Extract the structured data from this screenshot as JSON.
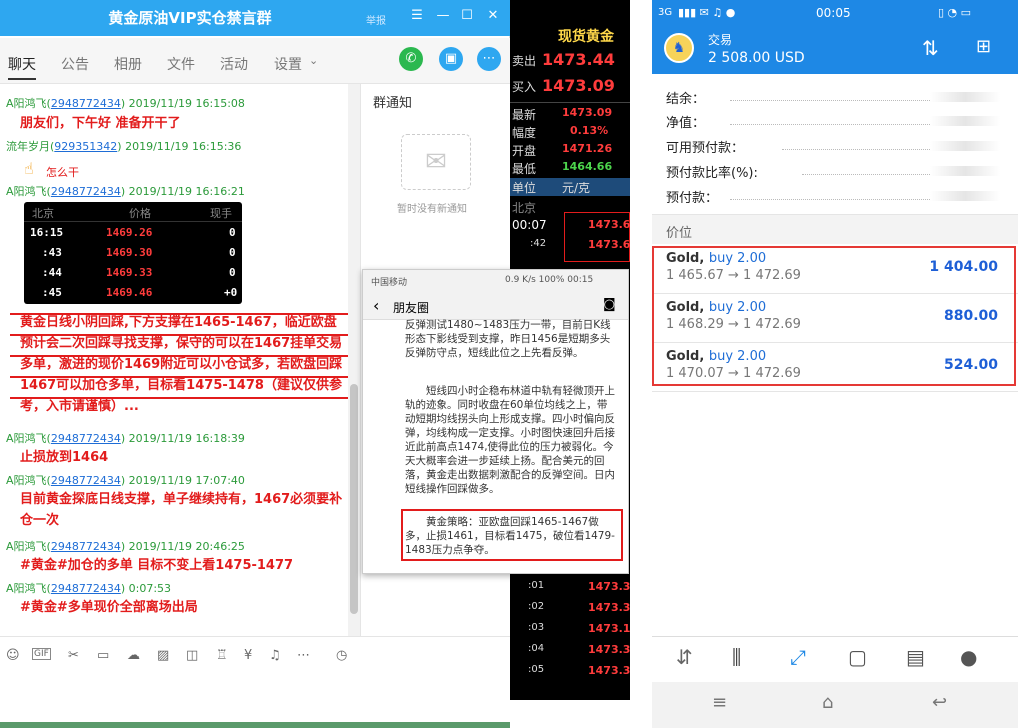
{
  "qq": {
    "title": "黄金原油VIP实仓禁言群",
    "report": "举报",
    "tabs": [
      "聊天",
      "公告",
      "相册",
      "文件",
      "活动",
      "设置"
    ],
    "messages": [
      {
        "name": "A阳鸿飞",
        "qq": "2948772434",
        "time": "2019/11/19 16:15:08",
        "text": "朋友们，下午好 准备开干了"
      },
      {
        "name": "流年岁月",
        "qq": "929351342",
        "time": "2019/11/19 16:15:36",
        "text": "怎么干"
      },
      {
        "name": "A阳鸿飞",
        "qq": "2948772434",
        "time": "2019/11/19 16:16:21"
      },
      {
        "text": "黄金日线小阴回踩,下方支撑在1465-1467，临近欧盘预计会二次回踩寻找支撑，保守的可以在1467挂单交易多单，激进的现价1469附近可以小仓试多，若欧盘回踩1467可以加仓多单，目标看1475-1478（建议仅供参考，入市请谨慎）..."
      },
      {
        "name": "A阳鸿飞",
        "qq": "2948772434",
        "time": "2019/11/19 16:18:39",
        "text": "止损放到1464"
      },
      {
        "name": "A阳鸿飞",
        "qq": "2948772434",
        "time": "2019/11/19 17:07:40",
        "text": "目前黄金探底日线支撑，单子继续持有，1467必须要补仓一次"
      },
      {
        "name": "A阳鸿飞",
        "qq": "2948772434",
        "time": "2019/11/19 20:46:25",
        "text": "#黄金#加仓的多单 目标不变上看1475-1477"
      },
      {
        "name": "A阳鸿飞",
        "qq": "2948772434",
        "time": "0:07:53",
        "text": "#黄金#多单现价全部离场出局"
      }
    ],
    "quote_table": {
      "headers": [
        "北京",
        "价格",
        "现手"
      ],
      "rows": [
        [
          "16:15",
          "1469.26",
          "0"
        ],
        [
          ":43",
          "1469.30",
          "0"
        ],
        [
          ":44",
          "1469.33",
          "0"
        ],
        [
          ":45",
          "1469.46",
          "+0"
        ]
      ]
    },
    "notice": {
      "title": "群通知",
      "empty": "暂时没有新通知"
    }
  },
  "quote_panel": {
    "title": "现货黄金",
    "sell_label": "卖出",
    "sell": "1473.44",
    "buy_label": "买入",
    "buy": "1473.09",
    "rows": [
      [
        "最新",
        "1473.09"
      ],
      [
        "幅度",
        "0.13%"
      ],
      [
        "开盘",
        "1471.26"
      ],
      [
        "最低",
        "1464.66"
      ]
    ],
    "unit_label": "单位",
    "unit": "元/克",
    "beijing": "北京",
    "ticks": [
      [
        "00:07",
        "1473.6"
      ],
      [
        ":42",
        "1473.6"
      ]
    ],
    "bottom_ticks": [
      [
        ":01",
        "1473.3"
      ],
      [
        ":02",
        "1473.3"
      ],
      [
        ":03",
        "1473.1"
      ],
      [
        ":04",
        "1473.3"
      ],
      [
        ":05",
        "1473.3"
      ]
    ]
  },
  "phone": {
    "carrier": "中国移动",
    "status_right": "0.9 K/s 100% 00:15",
    "header": "朋友圈",
    "paragraphs": [
      "反弹测试1480~1483压力一带，目前日K线形态下影线受到支撑，昨日1456是短期多头反弹防守点，短线此位之上先看反弹。",
      "短线四小时企稳布林道中轨有轻微顶开上轨的迹象。同时收盘在60单位均线之上，带动短期均线拐头向上形成支撑。四小时偏向反弹，均线构成一定支撑。小时图快速回升后接近此前高点1474,使得此位的压力被弱化。今天大概率会进一步延续上扬。配合美元的回落，黄金走出数据刺激配合的反弹空间。日内短线操作回踩做多。",
      "黄金策略：亚欧盘回踩1465-1467做多，止损1461，目标看1475，破位看1479-1483压力点争夺。"
    ]
  },
  "mt4": {
    "status_left": "3G",
    "time": "00:05",
    "title": "交易",
    "balance": "2 508.00 USD",
    "fields": [
      "结余：",
      "净值：",
      "可用预付款：",
      "预付款比率(%):",
      "预付款："
    ],
    "section": "价位",
    "positions": [
      {
        "symbol": "Gold,",
        "side": "buy 2.00",
        "prices": "1 465.67 → 1 472.69",
        "profit": "1 404.00"
      },
      {
        "symbol": "Gold,",
        "side": "buy 2.00",
        "prices": "1 468.29 → 1 472.69",
        "profit": "880.00"
      },
      {
        "symbol": "Gold,",
        "side": "buy 2.00",
        "prices": "1 470.07 → 1 472.69",
        "profit": "524.00"
      }
    ],
    "colors": {
      "accent": "#1e88e5",
      "highlight": "#e53935",
      "profit": "#1e5fd6"
    }
  }
}
